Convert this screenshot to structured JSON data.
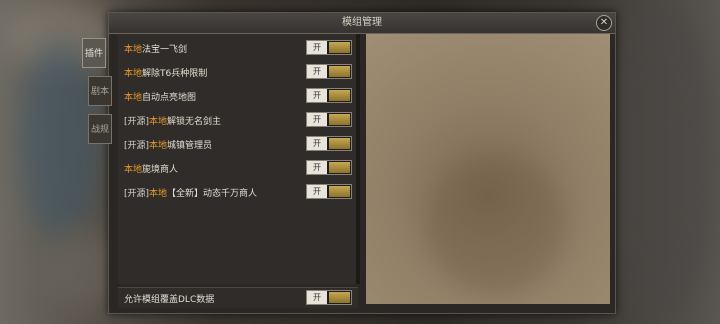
{
  "window": {
    "title": "模组管理"
  },
  "tabs": [
    {
      "label": "插件",
      "active": true
    },
    {
      "label": "剧本",
      "active": false
    },
    {
      "label": "战规",
      "active": false
    }
  ],
  "mods": [
    {
      "prefix": "",
      "source": "本地",
      "name": "法宝一飞剑",
      "toggle": "开"
    },
    {
      "prefix": "",
      "source": "本地",
      "name": "解除T6兵种限制",
      "toggle": "开"
    },
    {
      "prefix": "",
      "source": "本地",
      "name": "自动点亮地图",
      "toggle": "开"
    },
    {
      "prefix": "[开源]",
      "source": "本地",
      "name": "解锁无名剑主",
      "toggle": "开"
    },
    {
      "prefix": "[开源]",
      "source": "本地",
      "name": "城镇管理员",
      "toggle": "开"
    },
    {
      "prefix": "",
      "source": "本地",
      "name": "旎境商人",
      "toggle": "开"
    },
    {
      "prefix": "[开源]",
      "source": "本地",
      "name": "【全新】动态千万商人",
      "toggle": "开"
    }
  ],
  "footer": {
    "label": "允许模组覆盖DLC数据",
    "toggle": "开"
  },
  "colors": {
    "accent_source": "#e59a2c",
    "toggle_gold": "#c6a850"
  }
}
